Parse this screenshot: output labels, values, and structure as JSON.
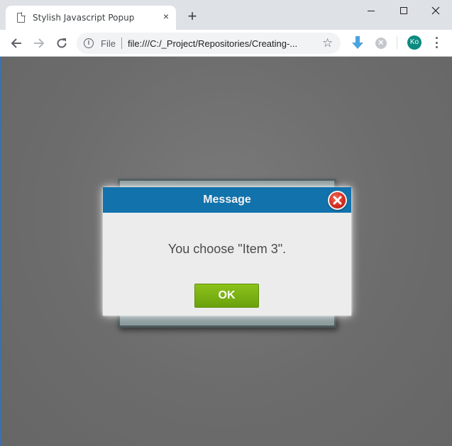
{
  "browser": {
    "tab_title": "Stylish Javascript Popup",
    "tab_close": "×",
    "new_tab": "+",
    "address": {
      "scheme_label": "File",
      "url": "file:///C:/_Project/Repositories/Creating-..."
    },
    "profile_initials": "Ko"
  },
  "popup": {
    "title": "Message",
    "message": "You choose \"Item 3\".",
    "ok_label": "OK",
    "header_color": "#1172ac",
    "ok_color": "#7bb214",
    "close_color": "#d42e20"
  },
  "page": {
    "background_color": "#6e6e6e"
  }
}
